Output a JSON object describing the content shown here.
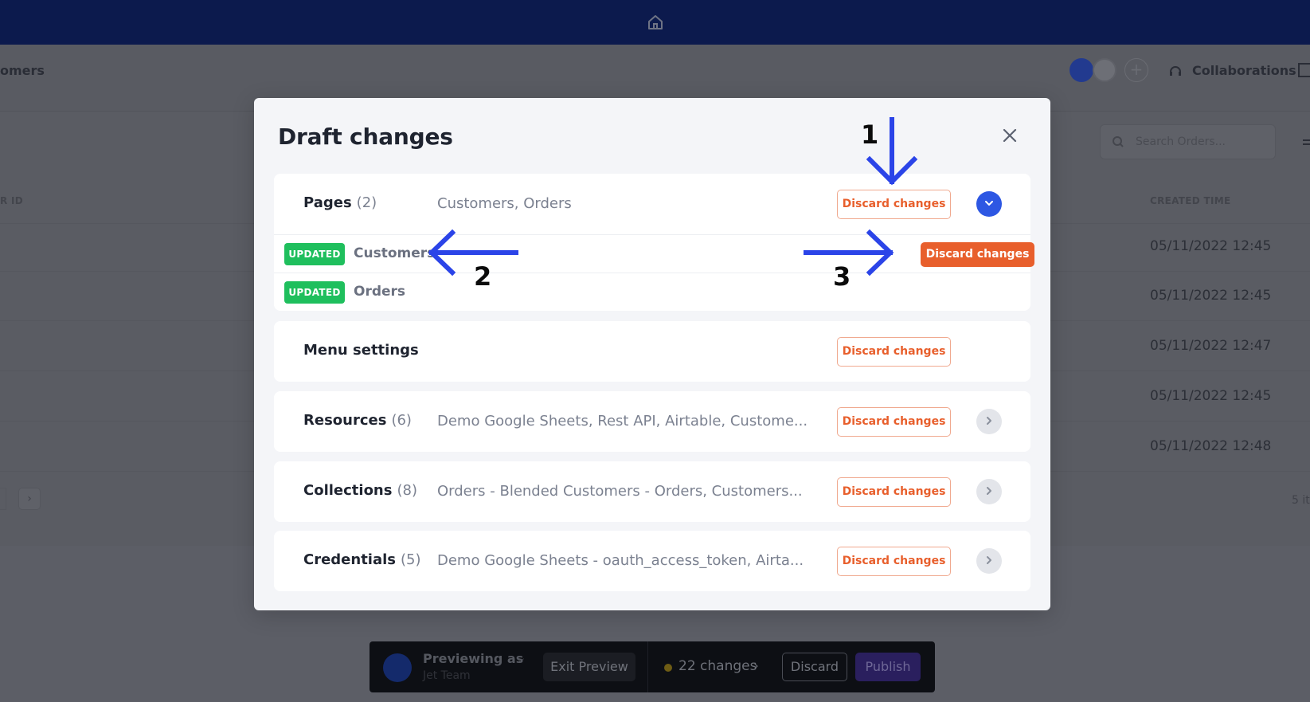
{
  "app": {
    "breadcrumb": "omers",
    "collaborations_label": "Collaborations",
    "search_placeholder": "Search Orders...",
    "columns": {
      "left": "R ID",
      "created_time": "CREATED TIME"
    },
    "rows": [
      {
        "created_time": "05/11/2022 12:45"
      },
      {
        "created_time": "05/11/2022 12:45"
      },
      {
        "created_time": "05/11/2022 12:47"
      },
      {
        "created_time": "05/11/2022 12:45"
      },
      {
        "created_time": "05/11/2022 12:48"
      }
    ],
    "pager_next": "›",
    "items_label": "5 it"
  },
  "preview_bar": {
    "previewing_as": "Previewing as",
    "team": "Jet Team",
    "exit_label": "Exit Preview",
    "changes_label": "22 changes",
    "discard_label": "Discard",
    "publish_label": "Publish"
  },
  "modal": {
    "title": "Draft changes",
    "cards": [
      {
        "name": "Pages",
        "count": "(2)",
        "desc": "Customers, Orders",
        "discard_label": "Discard changes",
        "expanded": true,
        "items": [
          {
            "badge": "UPDATED",
            "name": "Customers",
            "discard_label": "Discard changes"
          },
          {
            "badge": "UPDATED",
            "name": "Orders"
          }
        ]
      },
      {
        "name": "Menu settings",
        "count": "",
        "desc": "",
        "discard_label": "Discard changes"
      },
      {
        "name": "Resources",
        "count": "(6)",
        "desc": "Demo Google Sheets, Rest API, Airtable, Custome...",
        "discard_label": "Discard changes"
      },
      {
        "name": "Collections",
        "count": "(8)",
        "desc": "Orders - Blended Customers - Orders, Customers...",
        "discard_label": "Discard changes"
      },
      {
        "name": "Credentials",
        "count": "(5)",
        "desc": "Demo Google Sheets - oauth_access_token, Airta...",
        "discard_label": "Discard changes"
      }
    ]
  },
  "annotations": {
    "one": "1",
    "two": "2",
    "three": "3"
  },
  "colors": {
    "accent_orange": "#e85f2c",
    "badge_green": "#1fbf5d",
    "expand_blue": "#2d57e3",
    "arrow_blue": "#2b44e8",
    "topbar_navy": "#0c1a4d"
  },
  "icons": {
    "top": "home-icon",
    "close": "close-icon",
    "expand": "chevron-down-icon",
    "collapse": "chevron-right-icon"
  }
}
